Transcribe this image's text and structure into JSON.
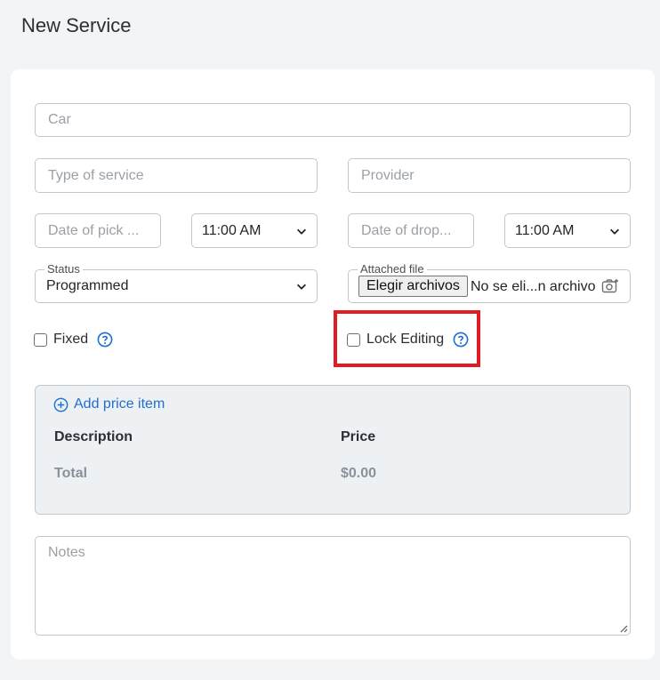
{
  "header": {
    "title": "New Service"
  },
  "form": {
    "car": {
      "placeholder": "Car",
      "value": ""
    },
    "type_of_service": {
      "placeholder": "Type of service",
      "value": ""
    },
    "provider": {
      "placeholder": "Provider",
      "value": ""
    },
    "pickup_date": {
      "placeholder": "Date of pick ...",
      "value": ""
    },
    "pickup_time": {
      "value": "11:00 AM"
    },
    "dropoff_date": {
      "placeholder": "Date of drop...",
      "value": ""
    },
    "dropoff_time": {
      "value": "11:00 AM"
    },
    "status": {
      "label": "Status",
      "value": "Programmed"
    },
    "attached_file": {
      "label": "Attached file",
      "button": "Elegir archivos",
      "file_text": "No se eli...n archivo"
    },
    "fixed": {
      "label": "Fixed",
      "checked": false
    },
    "lock_editing": {
      "label": "Lock Editing",
      "checked": false
    },
    "notes": {
      "placeholder": "Notes",
      "value": ""
    }
  },
  "price_panel": {
    "add_label": "Add price item",
    "columns": [
      "Description",
      "Price"
    ],
    "total_label": "Total",
    "total_value": "$0.00"
  },
  "colors": {
    "accent": "#1f6fd1",
    "highlight": "#e01b24"
  },
  "icons": {
    "help": "question-circle-icon",
    "add": "plus-circle-icon",
    "camera": "camera-add-icon",
    "chevron": "chevron-down-icon"
  }
}
